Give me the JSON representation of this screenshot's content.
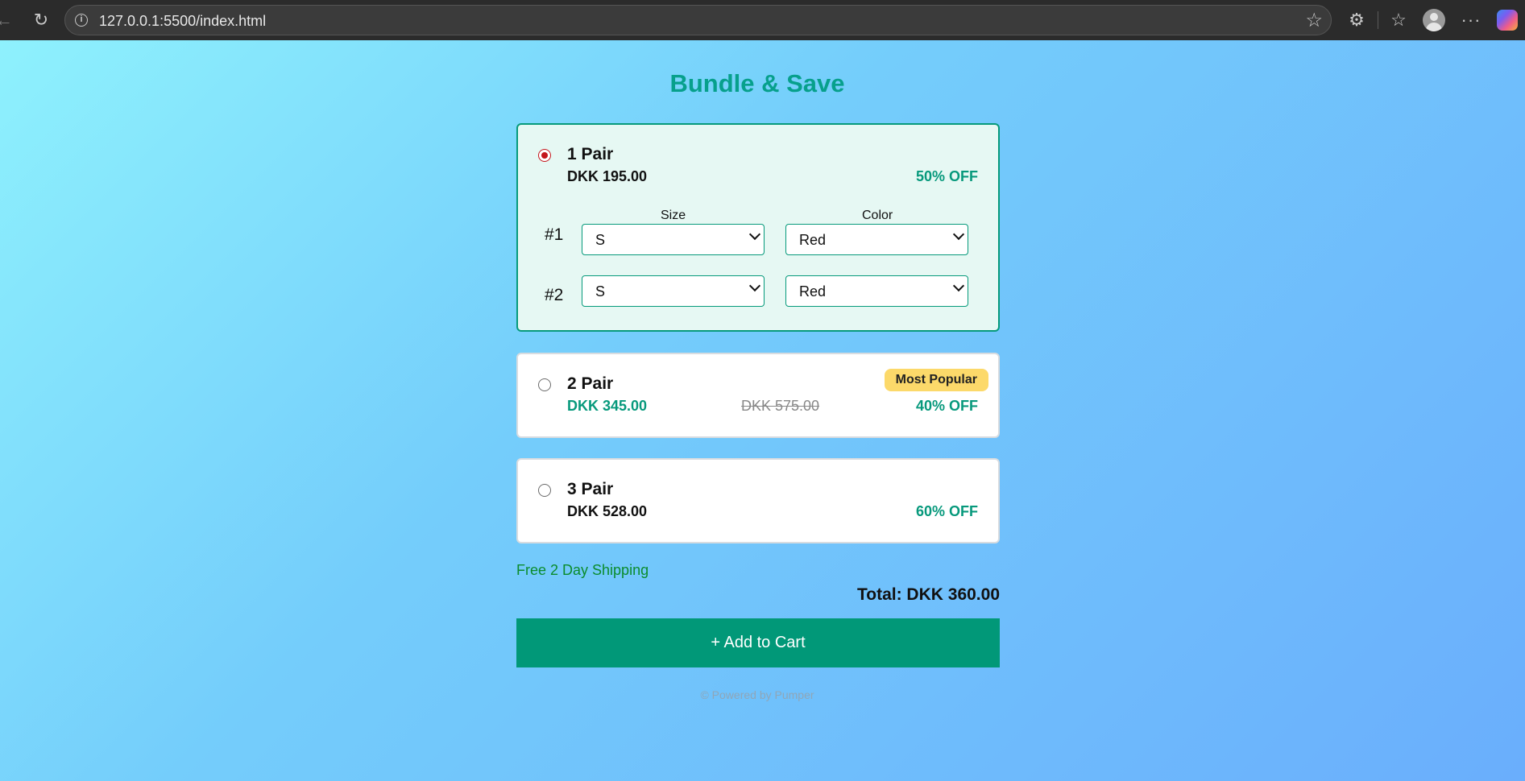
{
  "browser": {
    "url": "127.0.0.1:5500/index.html"
  },
  "page": {
    "heading": "Bundle & Save",
    "options": [
      {
        "title": "1 Pair",
        "price": "DKK 195.00",
        "discount": "50% OFF",
        "selected": true,
        "size_label": "Size",
        "color_label": "Color",
        "items": [
          {
            "number": "#1",
            "size": "S",
            "color": "Red"
          },
          {
            "number": "#2",
            "size": "S",
            "color": "Red"
          }
        ]
      },
      {
        "title": "2 Pair",
        "price": "DKK 345.00",
        "original_price": "DKK 575.00",
        "discount": "40% OFF",
        "badge": "Most Popular",
        "selected": false
      },
      {
        "title": "3 Pair",
        "price": "DKK 528.00",
        "discount": "60% OFF",
        "selected": false
      }
    ],
    "shipping": "Free 2 Day Shipping",
    "total": "Total: DKK 360.00",
    "add_to_cart": "+ Add to Cart",
    "footer": "© Powered by Pumper"
  },
  "colors": {
    "accent": "#019878",
    "selected_radio": "#c4161c",
    "badge": "#fcd96a",
    "shipping_text": "#0a8c2c"
  }
}
